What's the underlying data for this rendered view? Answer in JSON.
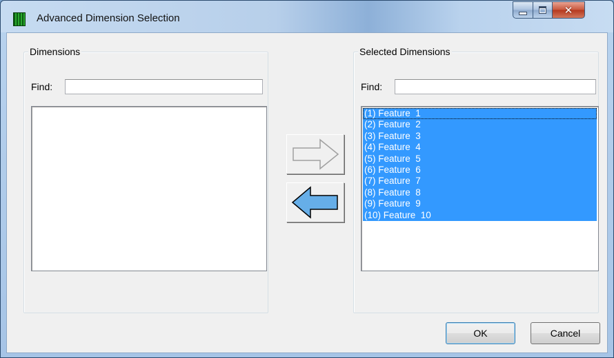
{
  "window": {
    "title": "Advanced Dimension Selection"
  },
  "left_panel": {
    "legend": "Dimensions",
    "find_label": "Find:",
    "find_value": "",
    "items": []
  },
  "right_panel": {
    "legend": "Selected Dimensions",
    "find_label": "Find:",
    "find_value": "",
    "items": [
      "(1) Feature  1",
      "(2) Feature  2",
      "(3) Feature  3",
      "(4) Feature  4",
      "(5) Feature  5",
      "(6) Feature  6",
      "(7) Feature  7",
      "(8) Feature  8",
      "(9) Feature  9",
      "(10) Feature  10"
    ]
  },
  "buttons": {
    "ok": "OK",
    "cancel": "Cancel"
  },
  "icons": {
    "add_arrow": "arrow-right-icon",
    "remove_arrow": "arrow-left-icon"
  },
  "colors": {
    "selection": "#3399ff",
    "arrow_fill": "#66aee8"
  }
}
